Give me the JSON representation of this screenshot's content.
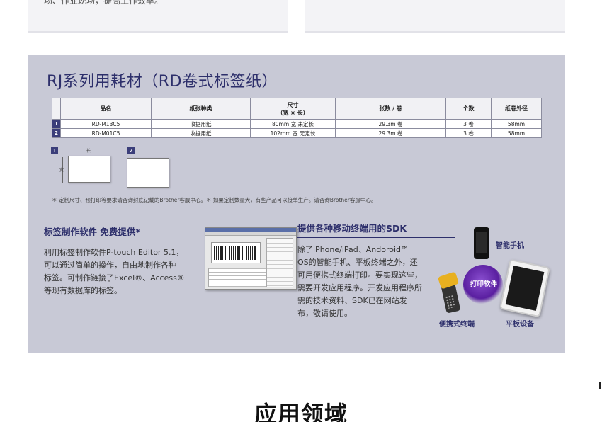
{
  "top_cards": {
    "left_partial_text": "场、作业现场，提高工作效率。"
  },
  "panel": {
    "title": "RJ系列用耗材（RD卷式标签纸）",
    "table": {
      "headers": [
        "品名",
        "纸张种类",
        "尺寸\n（宽 × 长）",
        "张数 / 卷",
        "个数",
        "纸卷外径"
      ],
      "rows": [
        {
          "num": "1",
          "cells": [
            "RD-M13C5",
            "收据用纸",
            "80mm 宽 未定长",
            "29.3m 卷",
            "3 卷",
            "58mm"
          ]
        },
        {
          "num": "2",
          "cells": [
            "RD-M01C5",
            "收据用纸",
            "102mm 宽 无定长",
            "29.3m 卷",
            "3 卷",
            "58mm"
          ]
        }
      ]
    },
    "diagram": {
      "badge1": "1",
      "badge2": "2",
      "width_label": "长",
      "height_label": "宽"
    },
    "note": "＊ 定制尺寸、预打印等要求请咨询封底记载的Brother客服中心。＊ 如果定制数量大，有些产品可以接单生产。请咨询Brother客服中心。",
    "software": {
      "title": "标签制作软件  免费提供*",
      "lines": [
        "利用标签制作软件P-touch Editor 5.1，",
        "可以通过简单的操作，自由地制作各种",
        "标签。可制作链接了Excel®、Access®",
        "等现有数据库的标签。"
      ]
    },
    "sdk": {
      "title": "提供各种移动终端用的SDK",
      "lines": [
        "除了iPhone/iPad、Andoroid™",
        "OS的智能手机、平板终端之外，还",
        "可用便携式终端打印。要实现这些，",
        "需要开发应用程序。开发应用程序所",
        "需的技术资料、SDK已在网站发",
        "布，敬请使用。"
      ]
    },
    "devices": {
      "hub": "打印软件",
      "phone": "智能手机",
      "handheld": "便携式终端",
      "tablet": "平板设备"
    }
  },
  "bottom_title": "应用领域"
}
